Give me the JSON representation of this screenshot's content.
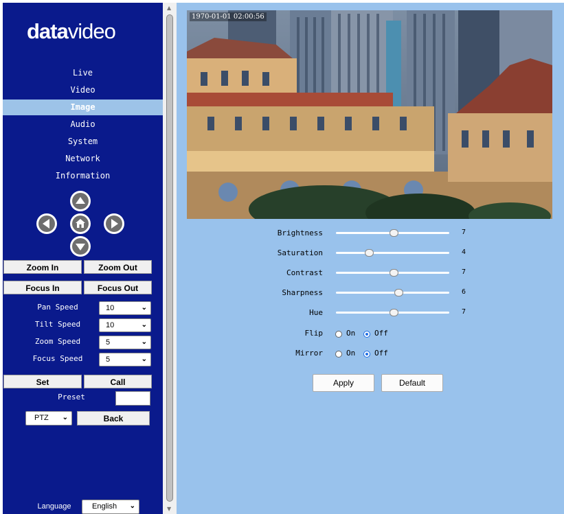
{
  "brand": {
    "bold": "data",
    "light": "video"
  },
  "nav": [
    {
      "label": "Live",
      "active": false
    },
    {
      "label": "Video",
      "active": false
    },
    {
      "label": "Image",
      "active": true
    },
    {
      "label": "Audio",
      "active": false
    },
    {
      "label": "System",
      "active": false
    },
    {
      "label": "Network",
      "active": false
    },
    {
      "label": "Information",
      "active": false
    }
  ],
  "ptz": {
    "zoom_in": "Zoom In",
    "zoom_out": "Zoom Out",
    "focus_in": "Focus In",
    "focus_out": "Focus Out",
    "pan_speed": {
      "label": "Pan Speed",
      "value": "10"
    },
    "tilt_speed": {
      "label": "Tilt Speed",
      "value": "10"
    },
    "zoom_speed": {
      "label": "Zoom Speed",
      "value": "5"
    },
    "focus_speed": {
      "label": "Focus Speed",
      "value": "5"
    },
    "set": "Set",
    "call": "Call",
    "preset_label": "Preset",
    "preset_value": "",
    "mode": "PTZ",
    "back": "Back"
  },
  "language": {
    "label": "Language",
    "value": "English"
  },
  "video": {
    "timestamp": "1970-01-01 02:00:56"
  },
  "settings": {
    "brightness": {
      "label": "Brightness",
      "value": "7",
      "fraction": 0.51
    },
    "saturation": {
      "label": "Saturation",
      "value": "4",
      "fraction": 0.29
    },
    "contrast": {
      "label": "Contrast",
      "value": "7",
      "fraction": 0.51
    },
    "sharpness": {
      "label": "Sharpness",
      "value": "6",
      "fraction": 0.55
    },
    "hue": {
      "label": "Hue",
      "value": "7",
      "fraction": 0.51
    },
    "flip": {
      "label": "Flip",
      "on": "On",
      "off": "Off",
      "selected": "off"
    },
    "mirror": {
      "label": "Mirror",
      "on": "On",
      "off": "Off",
      "selected": "off"
    }
  },
  "actions": {
    "apply": "Apply",
    "default": "Default"
  },
  "icons": [
    "arrow-up-icon",
    "arrow-left-icon",
    "home-icon",
    "arrow-right-icon",
    "arrow-down-icon",
    "chevron-down-icon"
  ]
}
